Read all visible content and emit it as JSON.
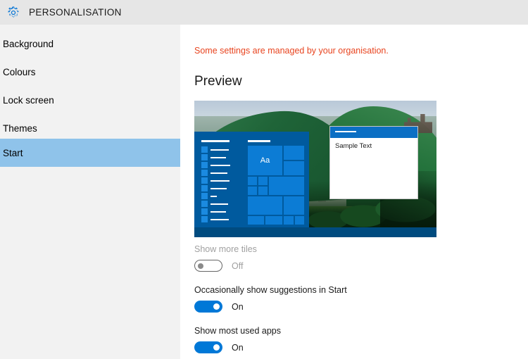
{
  "titlebar": {
    "icon": "gear-icon",
    "title": "PERSONALISATION"
  },
  "sidebar": {
    "items": [
      {
        "label": "Background",
        "selected": false
      },
      {
        "label": "Colours",
        "selected": false
      },
      {
        "label": "Lock screen",
        "selected": false
      },
      {
        "label": "Themes",
        "selected": false
      },
      {
        "label": "Start",
        "selected": true
      }
    ]
  },
  "content": {
    "managed_note": "Some settings are managed by your organisation.",
    "preview_heading": "Preview",
    "preview": {
      "sample_window_text": "Sample Text",
      "start_tile_text": "Aa",
      "wallpaper_description": "green river valley with town and castle",
      "accent_colour": "#005a9e",
      "taskbar_colour": "#004b7f"
    },
    "settings": [
      {
        "label": "Show more tiles",
        "state": "Off",
        "enabled": false
      },
      {
        "label": "Occasionally show suggestions in Start",
        "state": "On",
        "enabled": true
      },
      {
        "label": "Show most used apps",
        "state": "On",
        "enabled": true
      }
    ]
  },
  "colours": {
    "titlebar_bg": "#e6e6e6",
    "sidebar_bg": "#f2f2f2",
    "selection_bg": "#8fc3ea",
    "warning_text": "#e8441f",
    "toggle_on": "#0078d7"
  }
}
